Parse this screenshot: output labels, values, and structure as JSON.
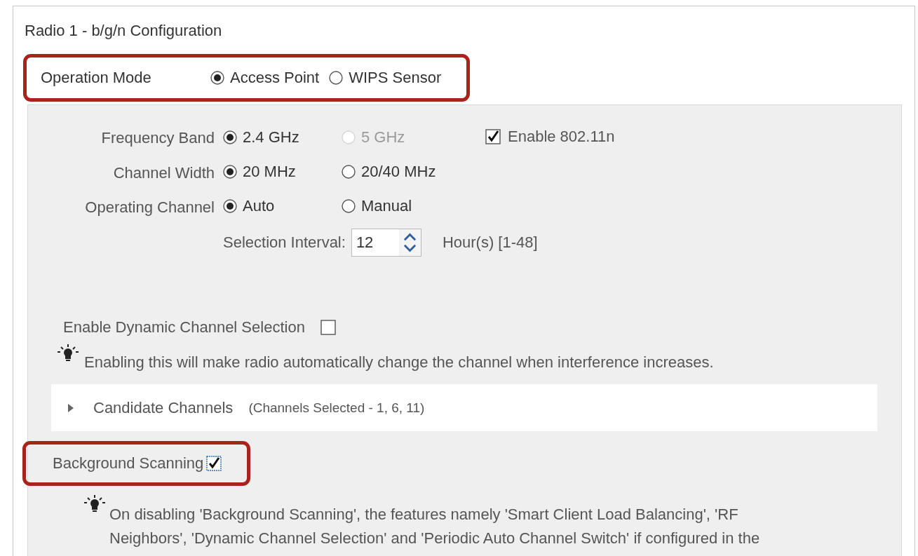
{
  "section": {
    "title": "Radio 1 - b/g/n Configuration"
  },
  "operation_mode": {
    "label": "Operation Mode",
    "highlighted": true,
    "options": [
      {
        "label": "Access Point",
        "selected": true
      },
      {
        "label": "WIPS Sensor",
        "selected": false
      }
    ]
  },
  "settings": [
    {
      "label": "Frequency Band",
      "options": [
        {
          "label": "2.4 GHz",
          "selected": true,
          "disabled": false
        },
        {
          "label": "5 GHz",
          "selected": false,
          "disabled": true
        }
      ],
      "checkbox": {
        "label": "Enable 802.11n",
        "checked": true
      }
    },
    {
      "label": "Channel Width",
      "options": [
        {
          "label": "20 MHz",
          "selected": true,
          "disabled": false
        },
        {
          "label": "20/40 MHz",
          "selected": false,
          "disabled": false
        }
      ]
    },
    {
      "label": "Operating Channel",
      "options": [
        {
          "label": "Auto",
          "selected": true,
          "disabled": false
        },
        {
          "label": "Manual",
          "selected": false,
          "disabled": false
        }
      ]
    }
  ],
  "selection_interval": {
    "label": "Selection Interval:",
    "value": "12",
    "unit": "Hour(s) [1-48]"
  },
  "dynamic_channel": {
    "label": "Enable Dynamic Channel Selection",
    "checked": false,
    "hint": "Enabling this will make radio automatically change the channel when interference increases."
  },
  "candidate_channels": {
    "label": "Candidate Channels",
    "summary": "(Channels Selected - 1, 6, 11)",
    "expanded": false
  },
  "background_scanning": {
    "label": "Background Scanning",
    "checked": true,
    "highlighted": true,
    "hint": "On disabling 'Background Scanning', the features namely 'Smart Client Load Balancing', 'RF Neighbors', 'Dynamic Channel Selection' and 'Periodic Auto Channel Switch' if configured in the"
  }
}
